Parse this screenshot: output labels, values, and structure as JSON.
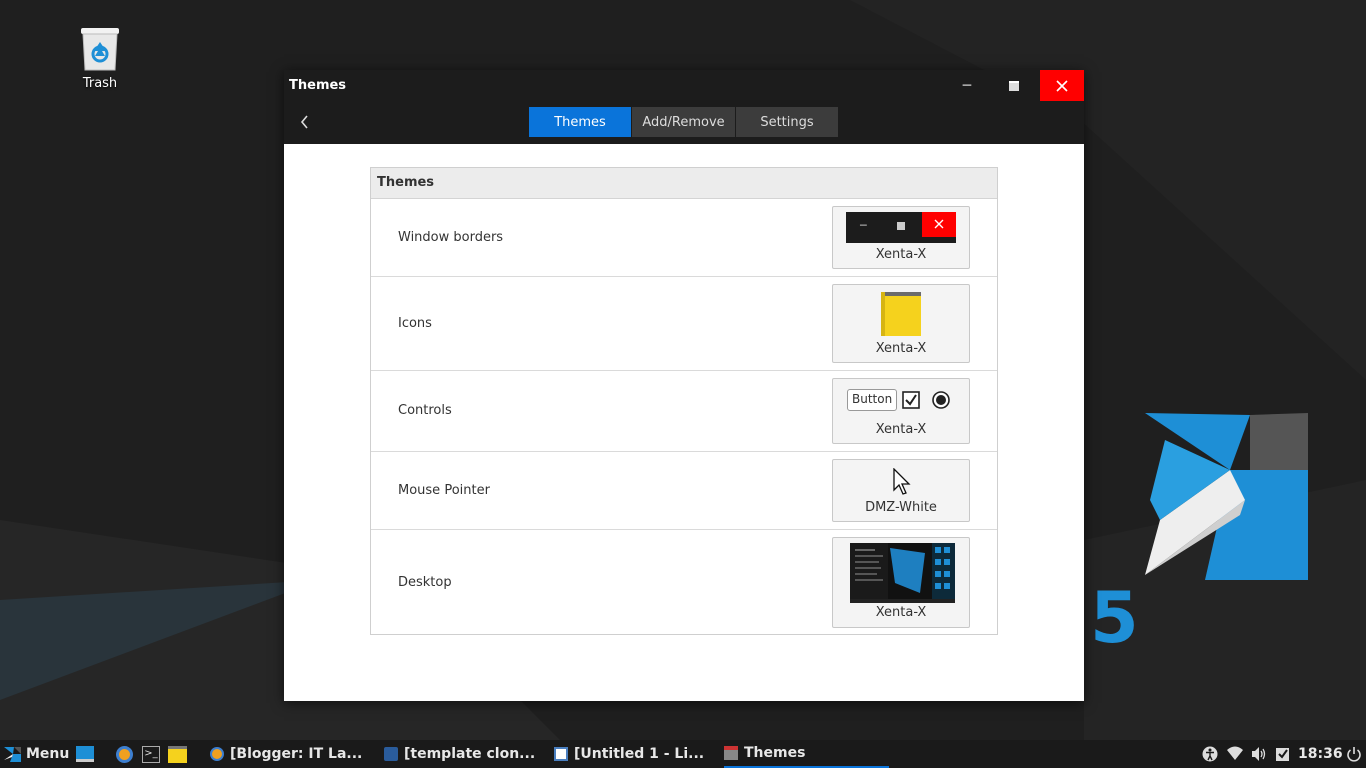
{
  "desktop": {
    "trash_label": "Trash"
  },
  "window": {
    "title": "Themes",
    "back_icon": "chevron-left-icon",
    "tabs": [
      {
        "label": "Themes",
        "active": true
      },
      {
        "label": "Add/Remove",
        "active": false
      },
      {
        "label": "Settings",
        "active": false
      }
    ]
  },
  "panel": {
    "header": "Themes",
    "rows": [
      {
        "label": "Window borders",
        "value": "Xenta-X"
      },
      {
        "label": "Icons",
        "value": "Xenta-X"
      },
      {
        "label": "Controls",
        "value": "Xenta-X",
        "button_text": "Button"
      },
      {
        "label": "Mouse Pointer",
        "value": "DMZ-White"
      },
      {
        "label": "Desktop",
        "value": "Xenta-X"
      }
    ]
  },
  "taskbar": {
    "menu_label": "Menu",
    "tasks": [
      {
        "label": "[Blogger: IT La...",
        "icon": "browser-icon"
      },
      {
        "label": "[template clon...",
        "icon": "editor-icon"
      },
      {
        "label": "[Untitled 1 - Li...",
        "icon": "document-icon"
      },
      {
        "label": "Themes",
        "icon": "themes-icon",
        "active": true
      }
    ],
    "clock": "18:36"
  },
  "colors": {
    "accent": "#0a74da",
    "close": "#ff0000",
    "titlebar": "#1c1c1c"
  }
}
